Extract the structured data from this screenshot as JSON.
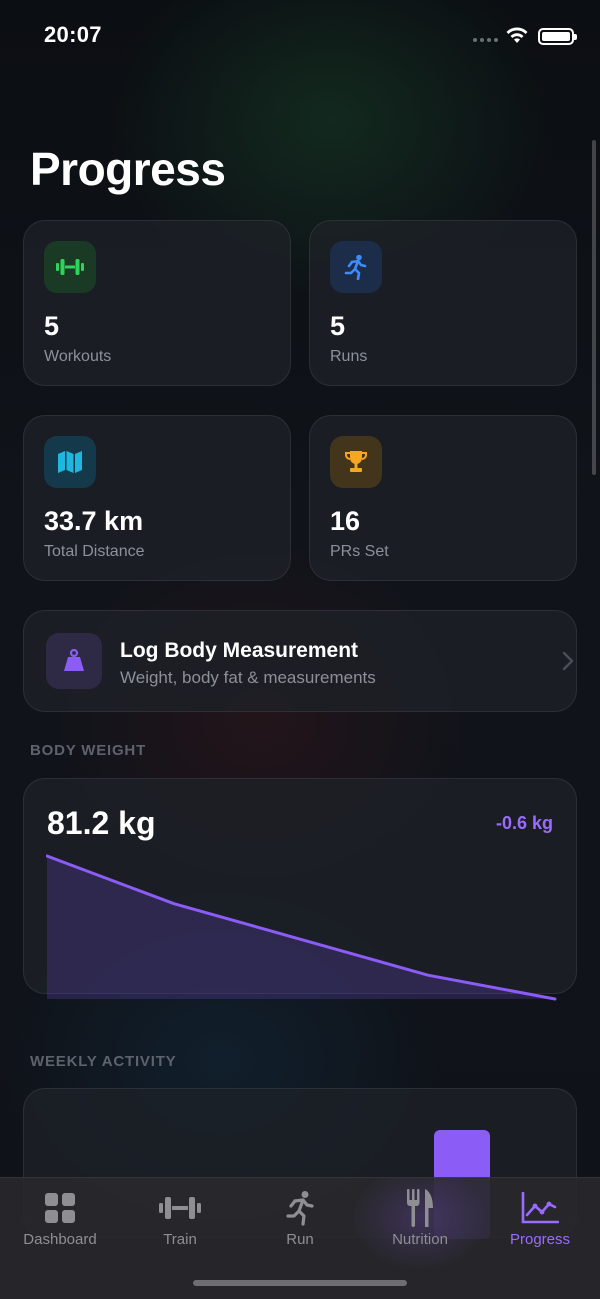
{
  "status_bar": {
    "time": "20:07"
  },
  "page": {
    "title": "Progress"
  },
  "stats": [
    {
      "value": "5",
      "label": "Workouts",
      "icon": "dumbbell-icon",
      "color": "#2fd35a",
      "bg": "#1b3a26"
    },
    {
      "value": "5",
      "label": "Runs",
      "icon": "runner-icon",
      "color": "#3b8cff",
      "bg": "#1c2d4a"
    },
    {
      "value": "33.7 km",
      "label": "Total Distance",
      "icon": "map-icon",
      "color": "#1fb6e0",
      "bg": "#14394a"
    },
    {
      "value": "16",
      "label": "PRs Set",
      "icon": "trophy-icon",
      "color": "#f5a623",
      "bg": "#43341c"
    }
  ],
  "log_body": {
    "title": "Log Body Measurement",
    "subtitle": "Weight, body fat & measurements",
    "icon": "scale-weight-icon"
  },
  "body_weight": {
    "section_label": "BODY WEIGHT",
    "current": "81.2 kg",
    "change": "-0.6 kg",
    "accent": "#8b5cf6"
  },
  "chart_data": {
    "type": "area",
    "values": [
      81.8,
      81.6,
      81.45,
      81.3,
      81.2
    ],
    "ylim": [
      81.2,
      81.8
    ]
  },
  "weekly_activity": {
    "section_label": "WEEKLY ACTIVITY",
    "bar_color": "#8b5cf6"
  },
  "tabs": [
    {
      "label": "Dashboard",
      "icon": "grid-icon",
      "active": false
    },
    {
      "label": "Train",
      "icon": "dumbbell-icon",
      "active": false
    },
    {
      "label": "Run",
      "icon": "runner-icon",
      "active": false
    },
    {
      "label": "Nutrition",
      "icon": "fork-knife-icon",
      "active": false
    },
    {
      "label": "Progress",
      "icon": "chart-line-icon",
      "active": true
    }
  ]
}
